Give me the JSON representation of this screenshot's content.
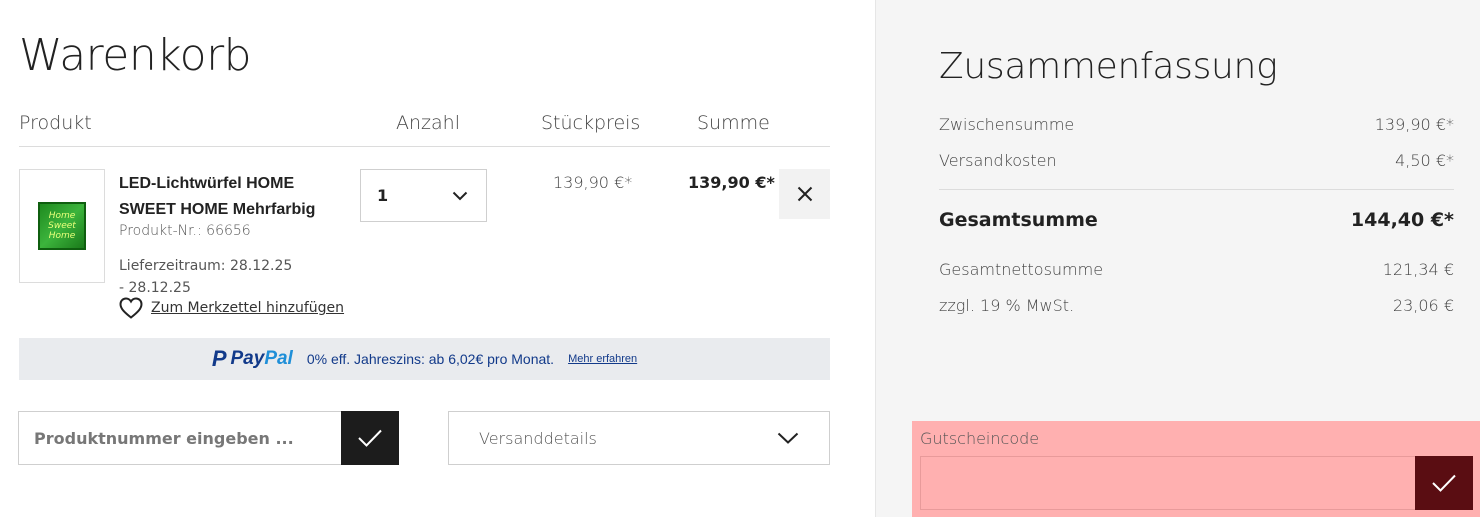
{
  "cart": {
    "title": "Warenkorb",
    "headers": {
      "product": "Produkt",
      "quantity": "Anzahl",
      "unit_price": "Stückpreis",
      "sum": "Summe"
    },
    "item": {
      "name": "LED-Lichtwürfel HOME SWEET HOME Mehrfarbig",
      "image_text": "Home Sweet Home",
      "product_number": "Produkt-Nr.: 66656",
      "delivery": "Lieferzeitraum: 28.12.25 - 28.12.25",
      "wishlist_label": "Zum Merkzettel hinzufügen",
      "quantity": "1",
      "unit_price": "139,90 €*",
      "sum": "139,90 €*"
    },
    "paypal": {
      "logo_mark": "P",
      "logo_pay": "Pay",
      "logo_pal": "Pal",
      "text": "0% eff. Jahreszins: ab 6,02€ pro Monat.",
      "link": "Mehr erfahren"
    },
    "product_number_input": {
      "placeholder": "Produktnummer eingeben ...",
      "value": ""
    },
    "shipping_details": "Versanddetails"
  },
  "summary": {
    "title": "Zusammenfassung",
    "subtotal_label": "Zwischensumme",
    "subtotal_value": "139,90 €*",
    "shipping_label": "Versandkosten",
    "shipping_value": "4,50 €*",
    "total_label": "Gesamtsumme",
    "total_value": "144,40 €*",
    "net_label": "Gesamtnettosumme",
    "net_value": "121,34 €",
    "tax_label": "zzgl. 19 % MwSt.",
    "tax_value": "23,06 €",
    "voucher": {
      "label": "Gutscheincode",
      "value": ""
    }
  },
  "colors": {
    "accent_dark": "#1c1c1c",
    "voucher_highlight": "#ffb0b0",
    "voucher_button": "#5a0d12",
    "paypal_blue": "#123a8a",
    "paypal_light": "#1f8fd8",
    "summary_bg": "#f5f5f5"
  },
  "icons": {
    "quantity_dropdown": "chevron-down-icon",
    "remove": "close-icon",
    "wishlist": "heart-icon",
    "submit": "checkmark-icon",
    "shipping_dropdown": "chevron-down-icon"
  }
}
